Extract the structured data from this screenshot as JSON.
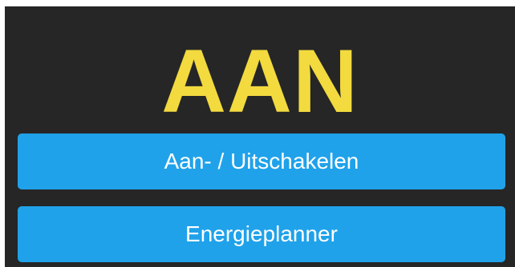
{
  "status": {
    "text": "AAN",
    "color": "#f2da3f"
  },
  "buttons": {
    "toggle_label": "Aan- / Uitschakelen",
    "planner_label": "Energieplanner",
    "color": "#1fa2ea"
  },
  "panel": {
    "background": "#262626"
  }
}
